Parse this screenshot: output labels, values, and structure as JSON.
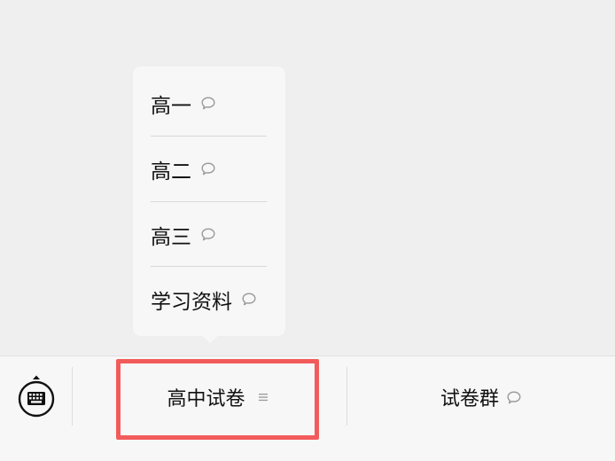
{
  "popup_menu": {
    "items": [
      {
        "label": "高一",
        "icon": "speech-bubble-icon"
      },
      {
        "label": "高二",
        "icon": "speech-bubble-icon"
      },
      {
        "label": "高三",
        "icon": "speech-bubble-icon"
      },
      {
        "label": "学习资料",
        "icon": "speech-bubble-icon"
      }
    ]
  },
  "bottom_bar": {
    "keyboard_icon": "keyboard-icon",
    "tabs": [
      {
        "label": "高中试卷",
        "icon": "menu-lines-icon"
      },
      {
        "label": "试卷群",
        "icon": "speech-bubble-icon"
      }
    ]
  },
  "colors": {
    "background": "#efefef",
    "panel": "#f7f7f7",
    "highlight": "#f25b5b",
    "text": "#111111",
    "icon": "#9a9a9a"
  }
}
